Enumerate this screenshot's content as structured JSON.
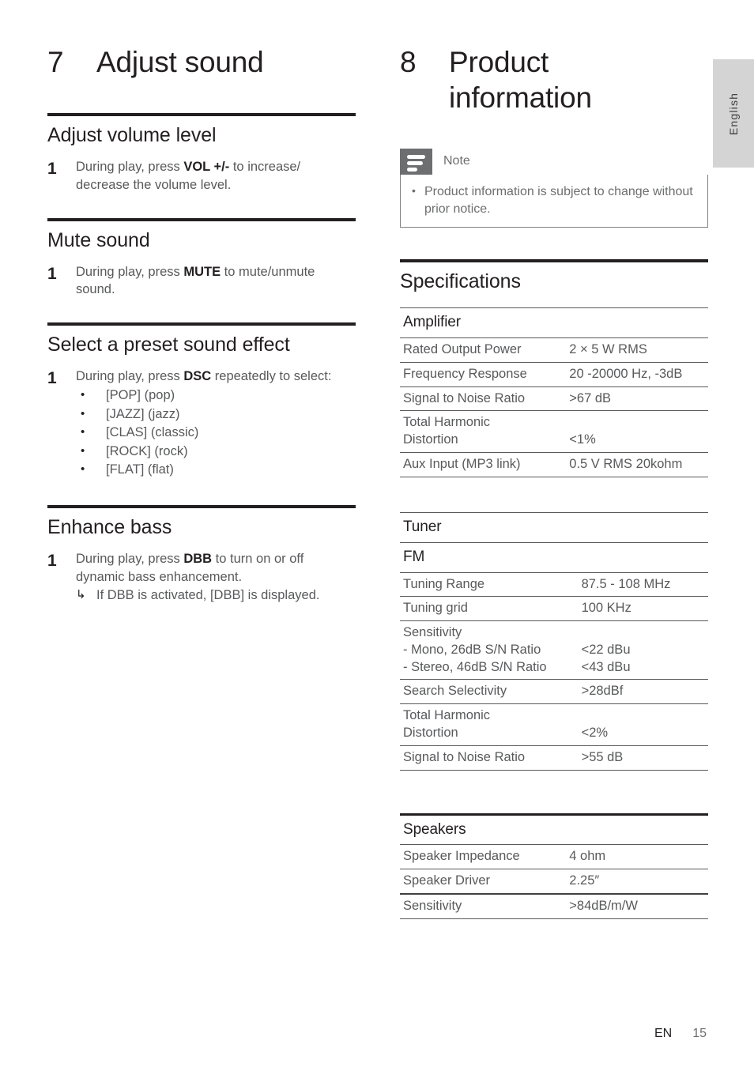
{
  "page": {
    "language_tab": "English",
    "footer_lang": "EN",
    "footer_page": "15"
  },
  "left_column": {
    "chapter": {
      "number": "7",
      "title": "Adjust sound"
    },
    "sections": [
      {
        "heading": "Adjust volume level",
        "step_number": "1",
        "step_text_pre": "During play, press ",
        "step_bold": "VOL +/-",
        "step_text_post": " to increase/ decrease the volume level."
      },
      {
        "heading": "Mute sound",
        "step_number": "1",
        "step_text_pre": "During play, press ",
        "step_bold": "MUTE",
        "step_text_post": " to mute/unmute sound."
      },
      {
        "heading": "Select a preset sound effect",
        "step_number": "1",
        "step_text_pre": "During play, press ",
        "step_bold": "DSC",
        "step_text_post": " repeatedly to select:",
        "bullet_marker": "•",
        "bullets": [
          "[POP] (pop)",
          "[JAZZ] (jazz)",
          "[CLAS] (classic)",
          "[ROCK] (rock)",
          "[FLAT] (flat)"
        ]
      },
      {
        "heading": "Enhance bass",
        "step_number": "1",
        "step_text_pre": "During play, press ",
        "step_bold": "DBB",
        "step_text_post": " to turn on or off dynamic bass enhancement.",
        "subnote_arrow": "↳",
        "subnote": "If DBB is activated, [DBB] is displayed."
      }
    ]
  },
  "right_column": {
    "chapter": {
      "number": "8",
      "title_line1": "Product",
      "title_line2": "information"
    },
    "note": {
      "icon": "note-lines-icon",
      "label": "Note",
      "bullet_marker": "•",
      "text": "Product information is subject to change without prior notice."
    },
    "specifications_heading": "Specifications",
    "spec_blocks": [
      {
        "heading": "Amplifier",
        "rows": [
          {
            "key": "Rated Output Power",
            "value": "2 × 5 W RMS"
          },
          {
            "key": "Frequency Response",
            "value": "20 -20000 Hz, -3dB"
          },
          {
            "key": "Signal to Noise Ratio",
            "value": ">67 dB"
          },
          {
            "key": "Total Harmonic\nDistortion",
            "value": "<1%",
            "value_align_bottom": true
          },
          {
            "key": "Aux Input (MP3 link)",
            "value": "0.5 V RMS 20kohm"
          }
        ]
      },
      {
        "heading": "Tuner",
        "subheading": "FM",
        "rows": [
          {
            "key": "Tuning Range",
            "value": "87.5 - 108 MHz"
          },
          {
            "key": "Tuning grid",
            "value": "100 KHz"
          },
          {
            "key": "Sensitivity\n - Mono, 26dB S/N Ratio\n - Stereo, 46dB S/N Ratio",
            "value": "\n<22 dBu\n<43 dBu"
          },
          {
            "key": "Search Selectivity",
            "value": ">28dBf"
          },
          {
            "key": "Total Harmonic\nDistortion",
            "value": "<2%",
            "value_align_bottom": true
          },
          {
            "key": "Signal to Noise Ratio",
            "value": ">55 dB"
          }
        ]
      },
      {
        "heading": "Speakers",
        "rows": [
          {
            "key": "Speaker Impedance",
            "value": "4 ohm"
          },
          {
            "key": "Speaker Driver",
            "value": "2.25″"
          },
          {
            "key": "Sensitivity",
            "value": ">84dB/m/W",
            "thick_top": true
          }
        ]
      }
    ]
  }
}
